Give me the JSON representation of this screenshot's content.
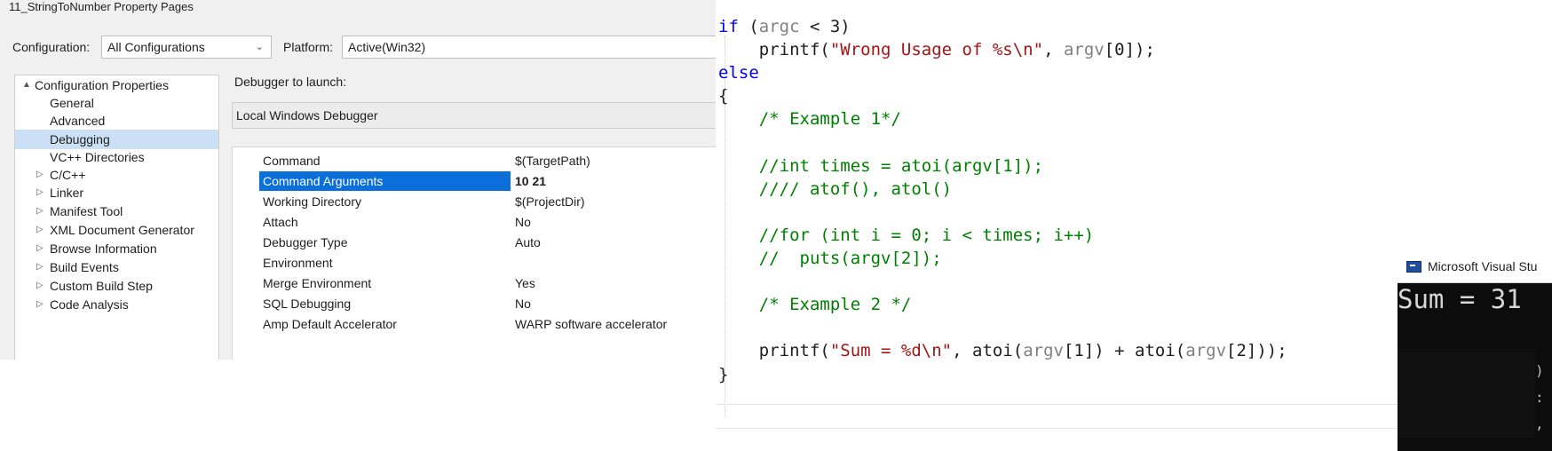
{
  "dialog": {
    "title": "11_StringToNumber Property Pages",
    "configuration_label": "Configuration:",
    "configuration_value": "All Configurations",
    "platform_label": "Platform:",
    "platform_value": "Active(Win32)",
    "tree": [
      {
        "label": "Configuration Properties",
        "expander": "▲"
      },
      {
        "label": "General",
        "expander": ""
      },
      {
        "label": "Advanced",
        "expander": ""
      },
      {
        "label": "Debugging",
        "expander": "",
        "selected": true
      },
      {
        "label": "VC++ Directories",
        "expander": ""
      },
      {
        "label": "C/C++",
        "expander": "▷"
      },
      {
        "label": "Linker",
        "expander": "▷"
      },
      {
        "label": "Manifest Tool",
        "expander": "▷"
      },
      {
        "label": "XML Document Generator",
        "expander": "▷"
      },
      {
        "label": "Browse Information",
        "expander": "▷"
      },
      {
        "label": "Build Events",
        "expander": "▷"
      },
      {
        "label": "Custom Build Step",
        "expander": "▷"
      },
      {
        "label": "Code Analysis",
        "expander": "▷"
      }
    ],
    "debugger_to_launch_label": "Debugger to launch:",
    "debugger_to_launch_value": "Local Windows Debugger",
    "properties": [
      {
        "name": "Command",
        "value": "$(TargetPath)"
      },
      {
        "name": "Command Arguments",
        "value": "10 21"
      },
      {
        "name": "Working Directory",
        "value": "$(ProjectDir)"
      },
      {
        "name": "Attach",
        "value": "No"
      },
      {
        "name": "Debugger Type",
        "value": "Auto"
      },
      {
        "name": "Environment",
        "value": ""
      },
      {
        "name": "Merge Environment",
        "value": "Yes"
      },
      {
        "name": "SQL Debugging",
        "value": "No"
      },
      {
        "name": "Amp Default Accelerator",
        "value": "WARP software accelerator"
      }
    ]
  },
  "code": {
    "lines": [
      "if (argc < 3)",
      "    printf(\"Wrong Usage of %s\\n\", argv[0]);",
      "else",
      "{",
      "    /* Example 1*/",
      "",
      "    //int times = atoi(argv[1]);",
      "    //// atof(), atol()",
      "",
      "    //for (int i = 0; i < times; i++)",
      "    //  puts(argv[2]);",
      "",
      "    /* Example 2 */",
      "",
      "    printf(\"Sum = %d\\n\", atoi(argv[1]) + atoi(argv[2]));",
      "}"
    ]
  },
  "console": {
    "title": "Microsoft Visual Stu",
    "output": "Sum = 31"
  },
  "colors": {
    "keyword": "#0000ff",
    "string": "#a31515",
    "comment": "#008000",
    "identifier": "#808080",
    "selection": "#0a6fd8"
  }
}
